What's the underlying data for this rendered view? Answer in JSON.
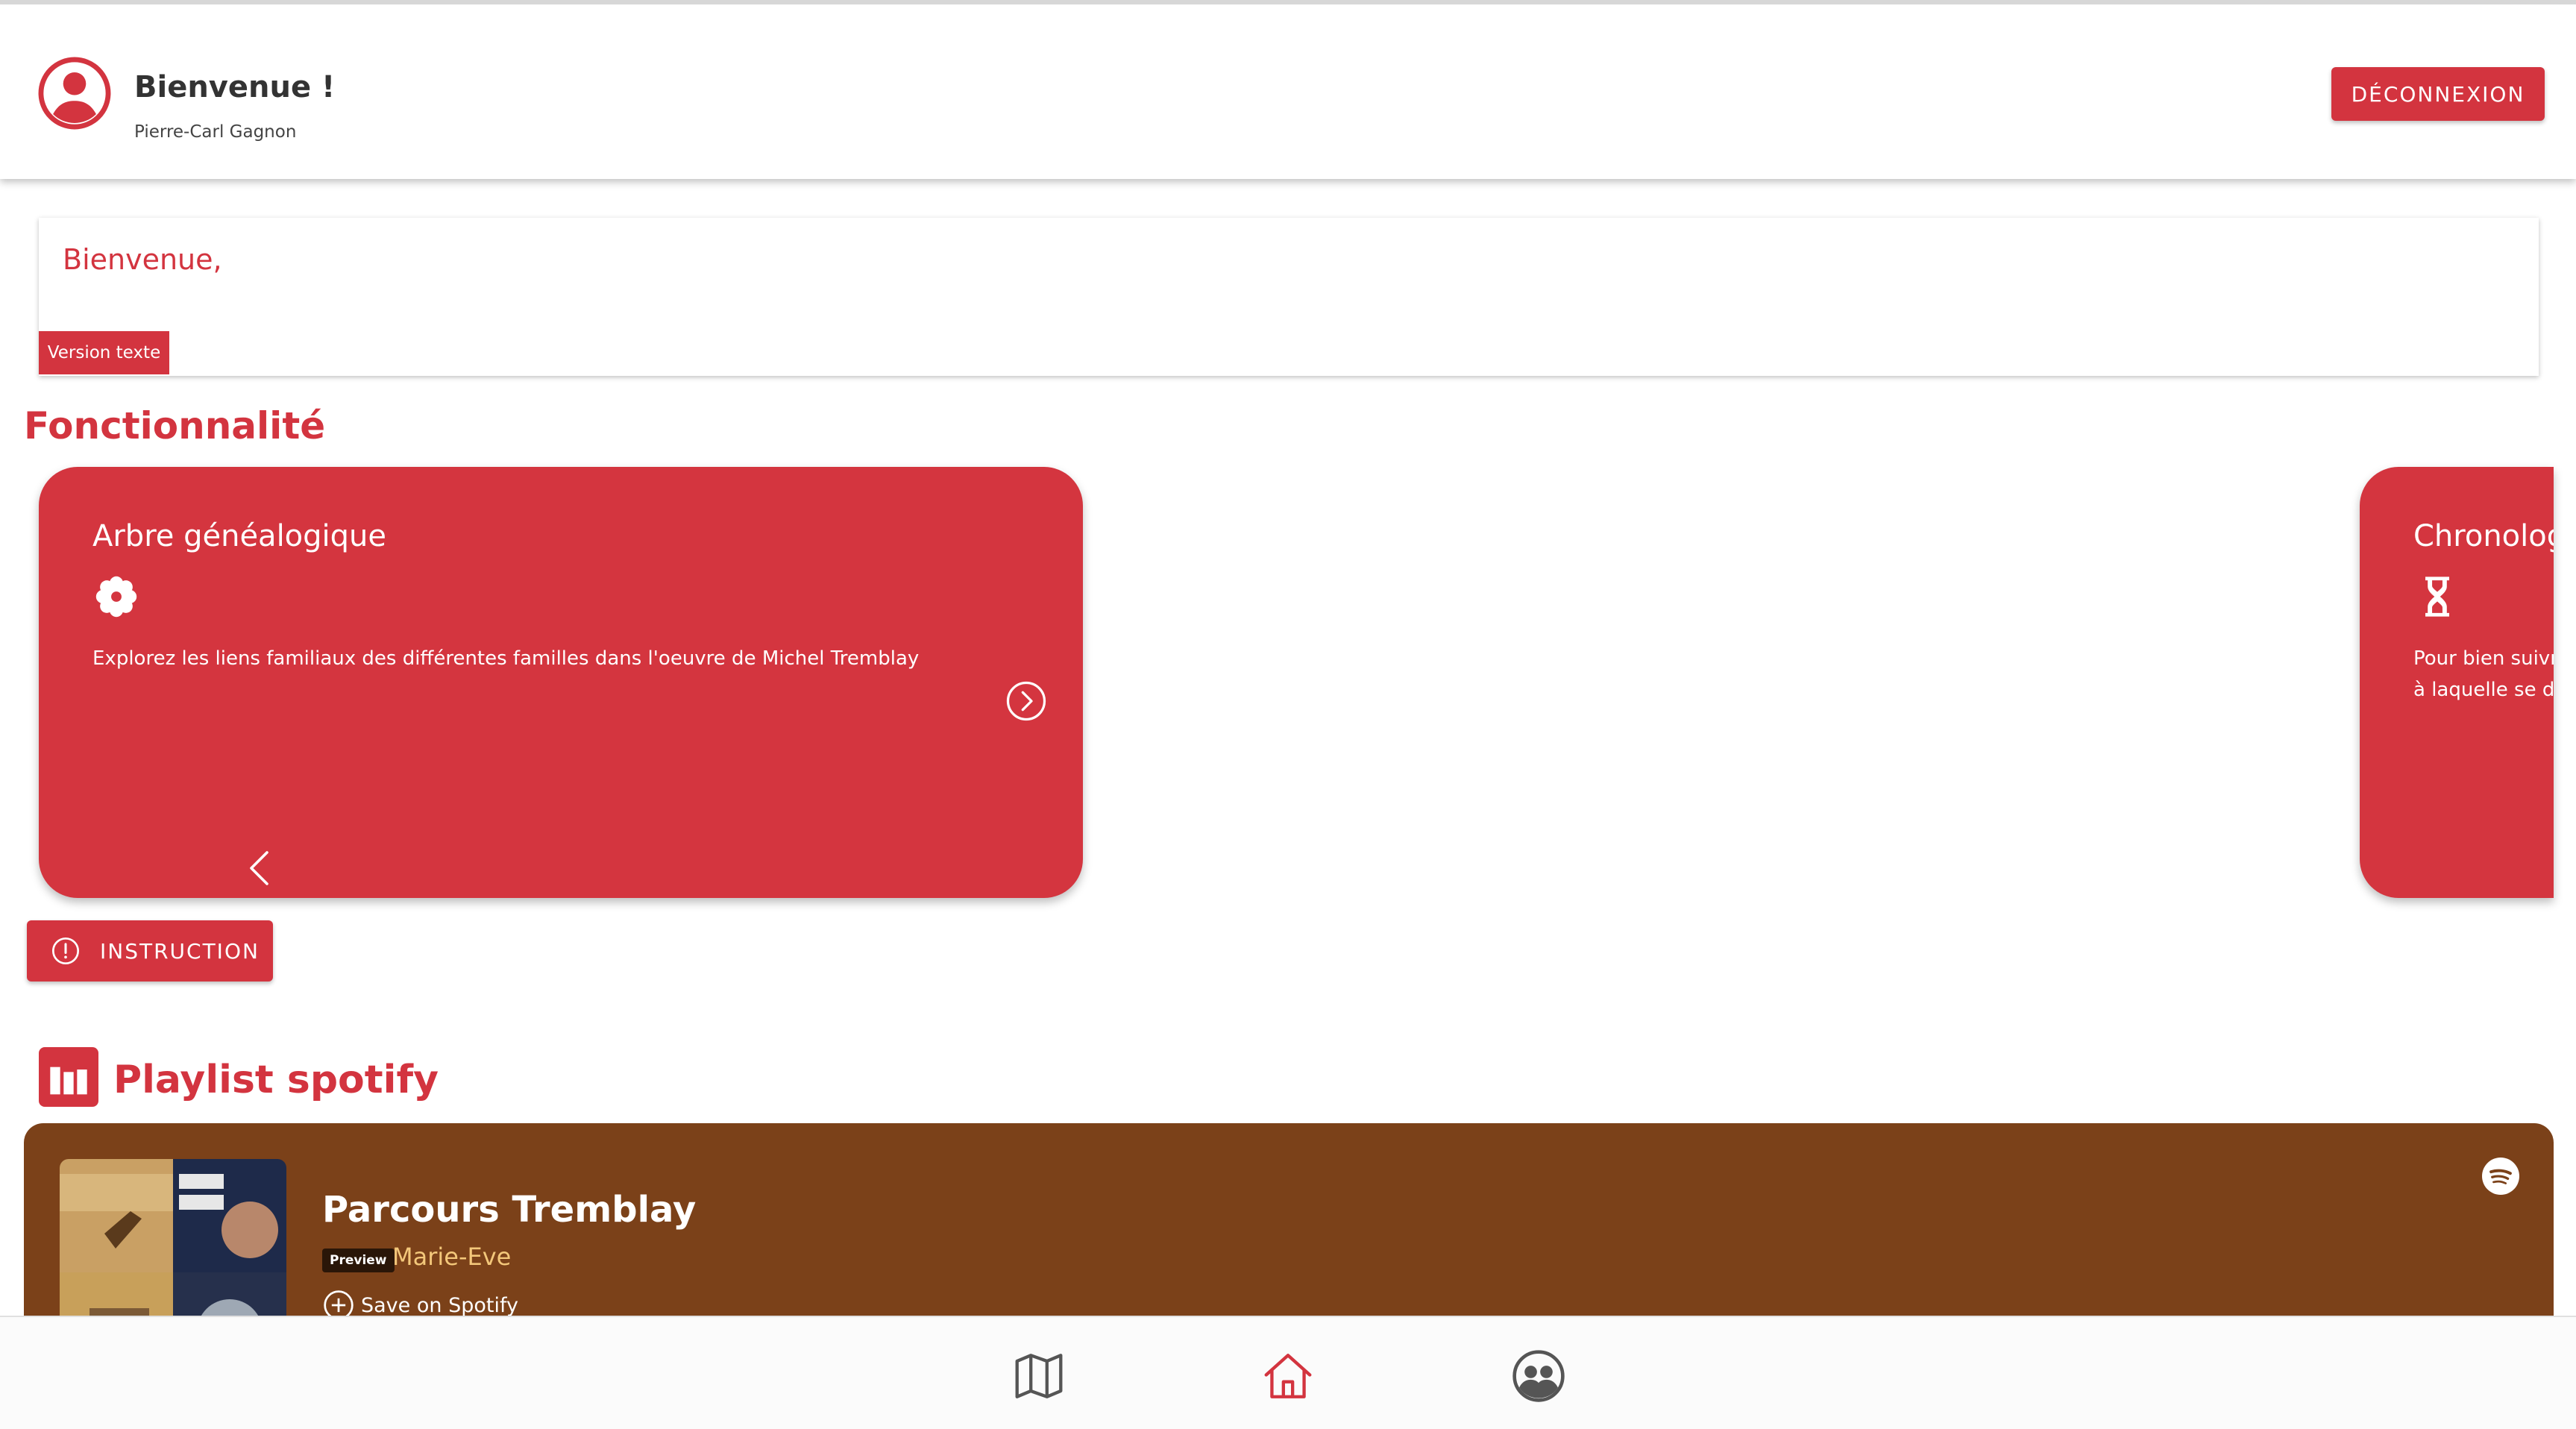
{
  "header": {
    "title": "Bienvenue !",
    "user_name": "Pierre-Carl Gagnon",
    "logout_label": "DÉCONNEXION",
    "avatar_icon": "account-circle-icon"
  },
  "welcome_card": {
    "text": "Bienvenue,",
    "text_version_label": "Version texte"
  },
  "features": {
    "title": "Fonctionnalité",
    "cards": [
      {
        "title": "Arbre généalogique",
        "icon": "flower-icon",
        "description": "Explorez les liens familiaux des différentes familles dans l'oeuvre de Michel Tremblay"
      },
      {
        "title": "Chronolog",
        "icon": "hourglass-icon",
        "description_line1": "Pour bien suivre",
        "description_line2": "à laquelle se dé"
      }
    ],
    "instruction_label": "INSTRUCTION"
  },
  "playlist": {
    "title": "Playlist spotify",
    "name": "Parcours Tremblay",
    "preview_badge": "Preview",
    "owner": "Marie-Eve",
    "save_label": "Save on Spotify"
  },
  "colors": {
    "brand_red": "#d3343f",
    "spotify_bg": "#7b4119",
    "owner_text": "#f3c77a"
  },
  "bottom_nav": {
    "items": [
      "map-icon",
      "home-icon",
      "people-icon"
    ],
    "active": "home-icon"
  }
}
